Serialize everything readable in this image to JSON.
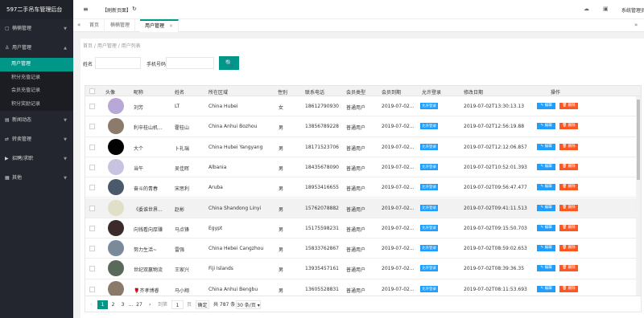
{
  "app": {
    "title": "597二手吊车管理后台"
  },
  "sidebar": {
    "menus": [
      {
        "label": "楠楠管理"
      },
      {
        "label": "用户管理"
      },
      {
        "label": "新闻动态"
      },
      {
        "label": "转卖管理"
      },
      {
        "label": "招聘/求职"
      },
      {
        "label": "其他"
      }
    ],
    "submenu": [
      {
        "label": "用户管理"
      },
      {
        "label": "积分充值记录"
      },
      {
        "label": "会员充值记录"
      },
      {
        "label": "积分奖励记录"
      }
    ]
  },
  "topbar": {
    "menu_icon": "≡",
    "refresh_label": "【刷新页面】",
    "refresh_icon": "↻",
    "icon1": "☁",
    "icon2": "▣",
    "user": "系统管理员"
  },
  "tabs": {
    "prev": "«",
    "next": "»",
    "items": [
      {
        "label": "首页"
      },
      {
        "label": "楠楠管理"
      },
      {
        "label": "用户管理"
      }
    ],
    "close": "×"
  },
  "breadcrumb": "首页 / 用户管理 / 用户列表",
  "search": {
    "name_label": "姓名",
    "phone_label": "手机号码",
    "btn": "🔍"
  },
  "table": {
    "headers": [
      "头像",
      "昵称",
      "姓名",
      "所在区域",
      "性别",
      "联系电话",
      "会员类型",
      "会员到期",
      "允许登录",
      "修改日期",
      "操作"
    ],
    "rows": [
      {
        "nick": "刘芳",
        "name": "LT",
        "area": "China Hubei",
        "sex": "女",
        "phone": "18612790930",
        "type": "普通用户",
        "exp": "2019-07-02...",
        "login": "允许登录",
        "date": "2019-07-02T13:30:13.13",
        "color": "#b7a8d8"
      },
      {
        "nick": "利辛桂山机...",
        "name": "霍桂山",
        "area": "China Anhui Bozhou",
        "sex": "男",
        "phone": "13856789228",
        "type": "普通用户",
        "exp": "2019-07-02...",
        "login": "允许登录",
        "date": "2019-07-02T12:56:19.88",
        "color": "#8c7a6a"
      },
      {
        "nick": "大个",
        "name": "卜礼瑞",
        "area": "China Hubei Yangyang",
        "sex": "男",
        "phone": "18171523706",
        "type": "普通用户",
        "exp": "2019-07-02...",
        "login": "允许登录",
        "date": "2019-07-02T12:12:06.857",
        "color": "#000000"
      },
      {
        "nick": "当午",
        "name": "吴佳晖",
        "area": "Albania",
        "sex": "男",
        "phone": "18435678090",
        "type": "普通用户",
        "exp": "2019-07-02...",
        "login": "允许登录",
        "date": "2019-07-02T10:52:01.393",
        "color": "#c9c2e0"
      },
      {
        "nick": "奋斗的青春",
        "name": "宋思利",
        "area": "Aruba",
        "sex": "男",
        "phone": "18953416655",
        "type": "普通用户",
        "exp": "2019-07-02...",
        "login": "允许登录",
        "date": "2019-07-02T09:56:47.477",
        "color": "#4a5a6a"
      },
      {
        "nick": "《委谁世界...",
        "name": "赵彬",
        "area": "China Shandong Linyi",
        "sex": "男",
        "phone": "15762078882",
        "type": "普通用户",
        "exp": "2019-07-02...",
        "login": "允许登录",
        "date": "2019-07-02T09:41:11.513",
        "color": "#e0dfc8"
      },
      {
        "nick": "向钱看向厚赚",
        "name": "马点锋",
        "area": "Egypt",
        "sex": "男",
        "phone": "15175598231",
        "type": "普通用户",
        "exp": "2019-07-02...",
        "login": "允许登录",
        "date": "2019-07-02T09:15:50.703",
        "color": "#3a2a2a"
      },
      {
        "nick": "努力生活~",
        "name": "雷强",
        "area": "China Hebei Cangzhou",
        "sex": "男",
        "phone": "15833762867",
        "type": "普通用户",
        "exp": "2019-07-02...",
        "login": "允许登录",
        "date": "2019-07-02T08:59:02.653",
        "color": "#7a8a9a"
      },
      {
        "nick": "世纪双赢物流",
        "name": "王家兴",
        "area": "Fiji Islands",
        "sex": "男",
        "phone": "13935457161",
        "type": "普通用户",
        "exp": "2019-07-02...",
        "login": "允许登录",
        "date": "2019-07-02T08:39:36.35",
        "color": "#5a6a5a"
      },
      {
        "nick": "🌹齐孝博睿",
        "name": "马小翔",
        "area": "China Anhui Bengbu",
        "sex": "男",
        "phone": "13605528831",
        "type": "普通用户",
        "exp": "2019-07-02...",
        "login": "允许登录",
        "date": "2019-07-02T08:11:53.693",
        "color": "#8a7a6a"
      }
    ],
    "edit": "✎ 编辑",
    "del": "🗑 删除"
  },
  "pager": {
    "prev": "‹",
    "pages": [
      "1",
      "2",
      "3",
      "...",
      "27"
    ],
    "next": "›",
    "goto": "到第",
    "page_val": "1",
    "page_unit": "页",
    "confirm": "确定",
    "total": "共 787 条",
    "size": "30 条/页 ▾"
  }
}
